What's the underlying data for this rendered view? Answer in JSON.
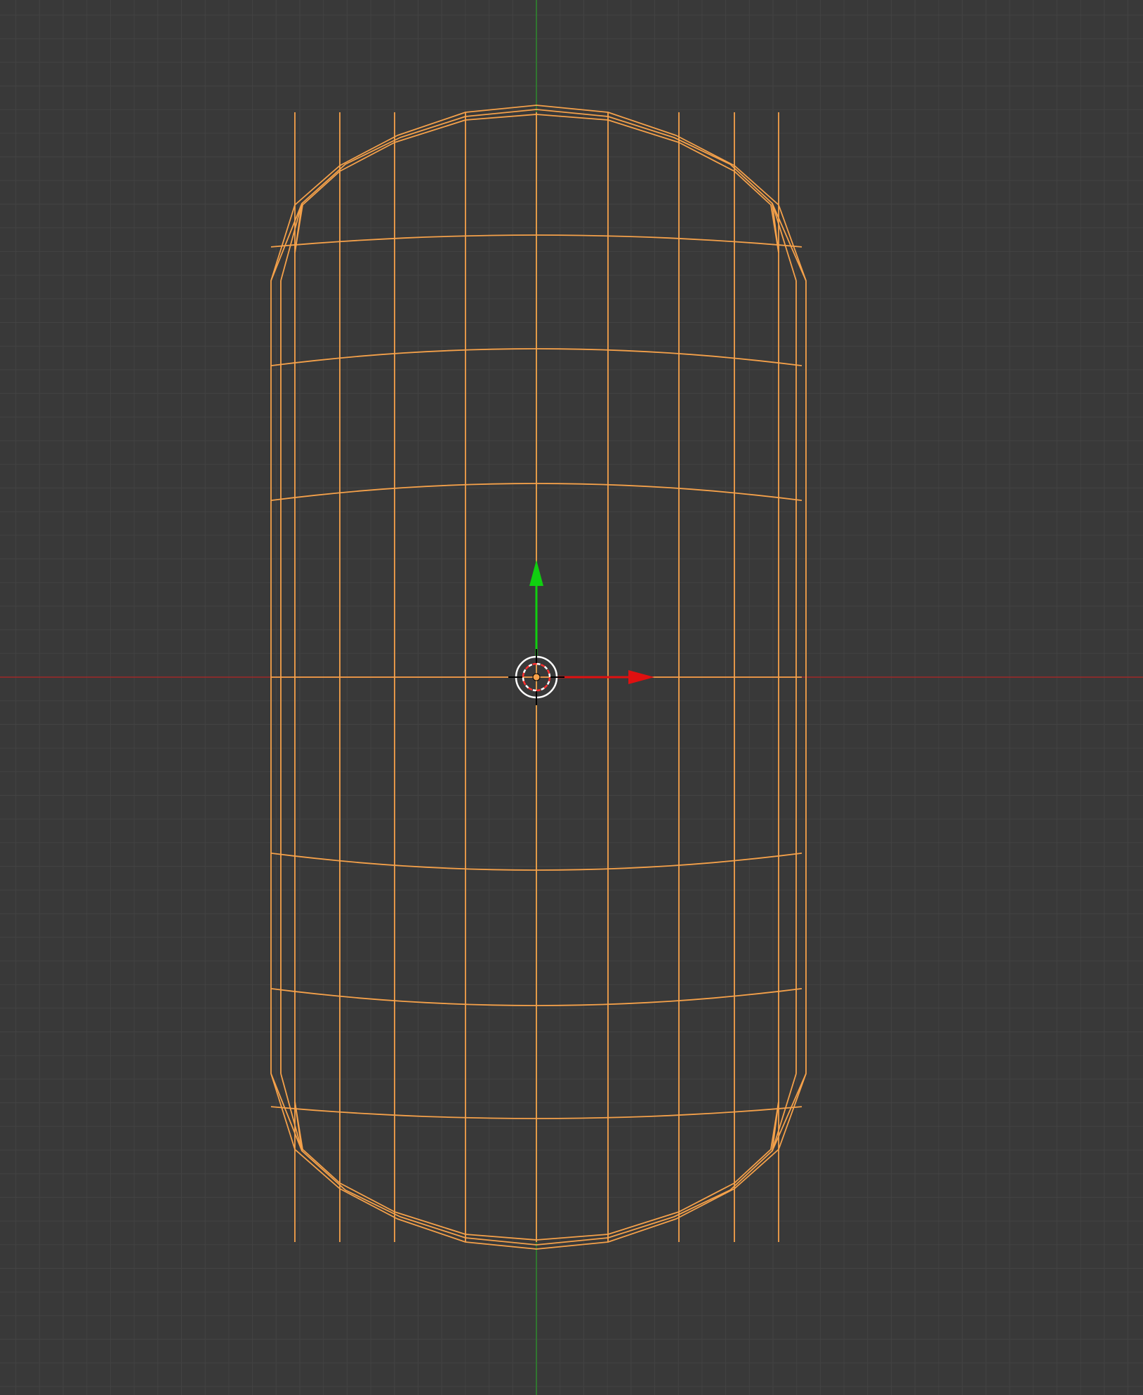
{
  "viewport": {
    "background_color": "#393939",
    "grid_color": "#434343",
    "x_axis_color": "#a02828",
    "y_axis_color": "#2d8a2d"
  },
  "selected_object": {
    "type": "capsule",
    "display": "wireframe",
    "selection_color": "#f5a14a"
  },
  "gizmo": {
    "type": "translate",
    "x_arrow_color": "#e01010",
    "y_arrow_color": "#10d010",
    "icon": "move-gizmo-icon"
  },
  "origin": {
    "icon": "3d-cursor-icon",
    "dot_color": "#f5a14a"
  }
}
